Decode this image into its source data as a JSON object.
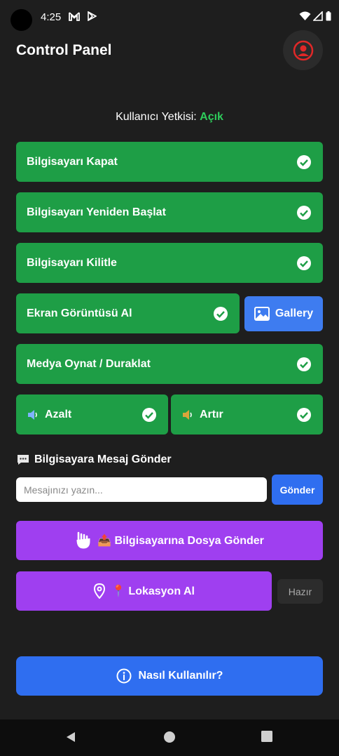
{
  "status_bar": {
    "time": "4:25"
  },
  "header": {
    "title": "Control Panel"
  },
  "permission": {
    "label": "Kullanıcı Yetkisi:",
    "value": "Açık"
  },
  "actions": {
    "shutdown": "Bilgisayarı Kapat",
    "restart": "Bilgisayarı Yeniden Başlat",
    "lock": "Bilgisayarı Kilitle",
    "screenshot": "Ekran Görüntüsü Al",
    "gallery": "Gallery",
    "media": "Medya Oynat / Duraklat",
    "volume_down": "Azalt",
    "volume_up": "Artır"
  },
  "message": {
    "section_title": "Bilgisayara Mesaj Gönder",
    "placeholder": "Mesajınızı yazın...",
    "send_label": "Gönder"
  },
  "file": {
    "label": "📤 Bilgisayarına Dosya Gönder"
  },
  "location": {
    "label": "📍 Lokasyon Al",
    "status": "Hazır"
  },
  "help": {
    "label": "Nasıl Kullanılır?"
  },
  "colors": {
    "background": "#1e1e1e",
    "success": "#1e9e46",
    "primary": "#2f6ef0",
    "purple": "#9f3ff0",
    "accent_red": "#e02828"
  }
}
